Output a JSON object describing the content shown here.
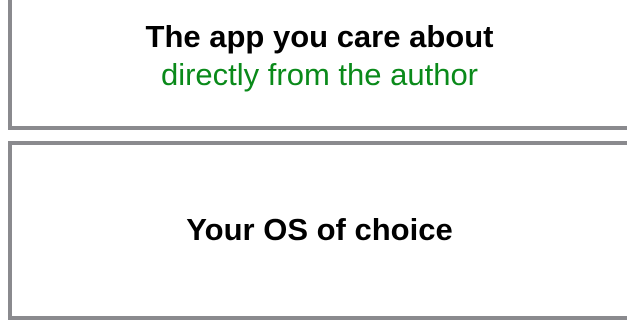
{
  "top_box": {
    "title": "The app you care about",
    "subtitle": "directly from the author"
  },
  "bottom_box": {
    "title": "Your OS of choice"
  },
  "colors": {
    "border": "#8a8a8e",
    "subtitle_text": "#0a8a1a",
    "title_text": "#000000"
  }
}
